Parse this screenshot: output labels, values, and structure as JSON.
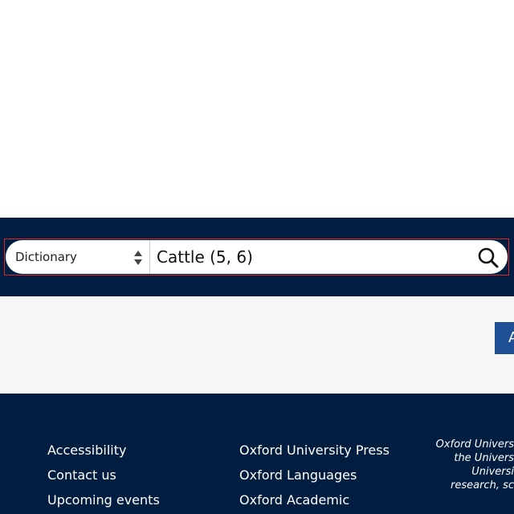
{
  "search": {
    "select_value": "Dictionary",
    "query": "Cattle (5, 6)"
  },
  "action": {
    "partial_label": "A"
  },
  "footer": {
    "col1": [
      "Accessibility",
      "Contact us",
      "Upcoming events"
    ],
    "col2": [
      "Oxford University Press",
      "Oxford Languages",
      "Oxford Academic"
    ],
    "blurb_lines": [
      "Oxford Univers",
      "the Univers",
      "Universi",
      "research, sc"
    ]
  },
  "colors": {
    "navy": "#011e41",
    "highlight_border": "#e0282a",
    "button_blue": "#1f5096"
  },
  "icons": {
    "select_arrows": "up-down-arrows-icon",
    "search": "search-icon"
  }
}
